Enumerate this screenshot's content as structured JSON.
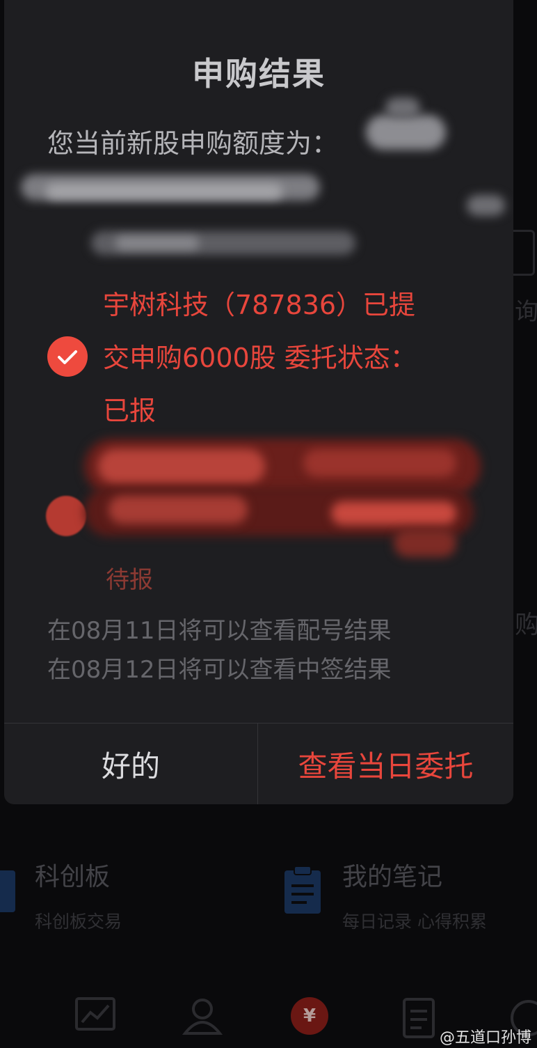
{
  "background": {
    "right_edge_fragments": [
      "询",
      "购"
    ],
    "cards": [
      {
        "title": "科创板",
        "subtitle": "科创板交易",
        "icon": "kechuang-icon"
      },
      {
        "title": "我的笔记",
        "subtitle": "每日记录 心得积累",
        "icon": "clipboard-icon"
      }
    ],
    "bottom_nav": [
      {
        "icon": "chart-icon"
      },
      {
        "icon": "user-icon"
      },
      {
        "icon": "yuan-icon",
        "glyph": "¥",
        "active": true
      },
      {
        "icon": "document-icon"
      },
      {
        "icon": "wealth-icon"
      }
    ]
  },
  "dialog": {
    "title": "申购结果",
    "quota_label": "您当前新股申购额度为：",
    "result": {
      "line1": "宇树科技（787836）已提",
      "line2": "交申购6000股 委托状态：",
      "line3": "已报"
    },
    "obscured_status": "待报",
    "info": [
      "在08月11日将可以查看配号结果",
      "在08月12日将可以查看中签结果"
    ],
    "buttons": {
      "ok": "好的",
      "view": "查看当日委托"
    }
  },
  "watermark": "@五道口孙博",
  "colors": {
    "accent_red": "#e8463c",
    "dialog_bg": "#1e1e21",
    "page_bg": "#0e0e10"
  }
}
